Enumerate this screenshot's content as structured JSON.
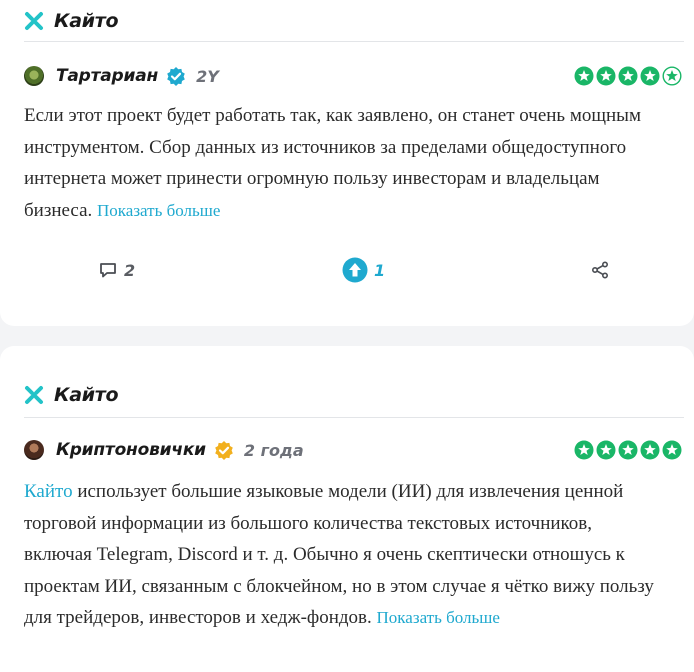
{
  "colors": {
    "accent": "#1fa9cf",
    "star_green": "#1ab667",
    "verified": "#1fa9cf",
    "verified_gold": "#f2b01e"
  },
  "reviews": [
    {
      "project": {
        "name": "Кайто",
        "logo_icon": "kaito-logo-icon"
      },
      "author": {
        "name": "Тартариан",
        "verified_icon": "verified-badge-icon",
        "age": "2Y"
      },
      "rating": 4,
      "text": "Если этот проект будет работать так, как заявлено, он станет очень мощным инструментом. Сбор данных из источников за пределами общедоступного интернета может принести огромную пользу инвесторам и владельцам бизнеса.",
      "show_more": "Показать больше",
      "actions": {
        "comments": "2",
        "upvotes": "1",
        "share_icon": "share-icon"
      }
    },
    {
      "project": {
        "name": "Кайто",
        "logo_icon": "kaito-logo-icon"
      },
      "author": {
        "name": "Криптоновички",
        "verified_icon": "verified-badge-icon",
        "age": "2 года"
      },
      "rating": 5,
      "text_link": "Кайто",
      "text": " использует большие языковые модели (ИИ) для извлечения ценной торговой информации из большого количества текстовых источников, включая Telegram, Discord и т. д. Обычно я очень скептически отношусь к проектам ИИ, связанным с блокчейном, но в этом случае я чётко вижу пользу для трейдеров, инвесторов и хедж-фондов.",
      "show_more": "Показать больше"
    }
  ]
}
